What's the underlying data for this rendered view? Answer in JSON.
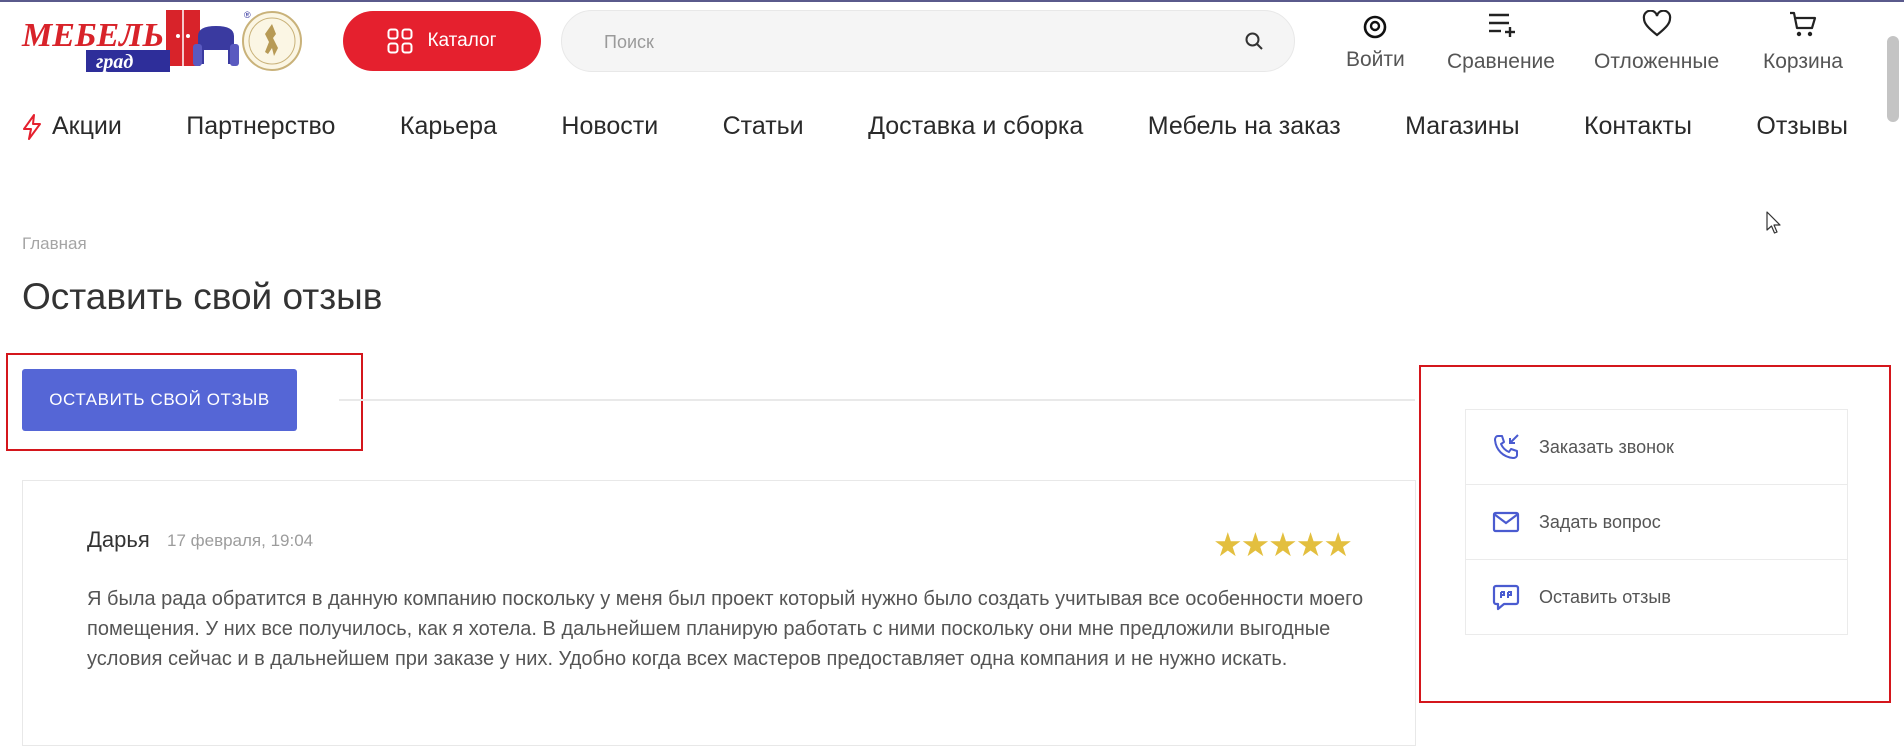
{
  "header": {
    "logo_alt": "Мебель град",
    "catalog_label": "Каталог",
    "search_placeholder": "Поиск",
    "actions": [
      {
        "label": "Войти",
        "icon": "user-icon"
      },
      {
        "label": "Сравнение",
        "icon": "compare-icon"
      },
      {
        "label": "Отложенные",
        "icon": "heart-icon"
      },
      {
        "label": "Корзина",
        "icon": "cart-icon"
      }
    ]
  },
  "nav": {
    "items": [
      "Акции",
      "Партнерство",
      "Карьера",
      "Новости",
      "Статьи",
      "Доставка и сборка",
      "Мебель на заказ",
      "Магазины",
      "Контакты",
      "Отзывы"
    ],
    "promo_icon": "lightning-icon"
  },
  "breadcrumb": {
    "home": "Главная"
  },
  "page": {
    "title": "Оставить свой отзыв",
    "review_button": "ОСТАВИТЬ СВОЙ ОТЗЫВ"
  },
  "review": {
    "author": "Дарья",
    "date": "17 февраля, 19:04",
    "rating": 5,
    "stars": "★★★★★",
    "text": "Я была рада обратится в данную компанию поскольку у меня был проект который нужно было создать учитывая все особенности моего помещения. У них все получилось, как я хотела. В дальнейшем планирую работать с ними поскольку они мне предложили выгодные условия сейчас и в дальнейшем при заказе у них. Удобно когда всех мастеров предоставляет одна компания и не нужно искать."
  },
  "sidebar": {
    "items": [
      {
        "label": "Заказать звонок",
        "icon": "phone-callback-icon"
      },
      {
        "label": "Задать вопрос",
        "icon": "envelope-icon"
      },
      {
        "label": "Оставить отзыв",
        "icon": "chat-quote-icon"
      }
    ]
  },
  "colors": {
    "brand_red": "#e5202e",
    "button_blue": "#5566d6",
    "star_gold": "#e3bf3f",
    "highlight_red": "#d4161c"
  }
}
